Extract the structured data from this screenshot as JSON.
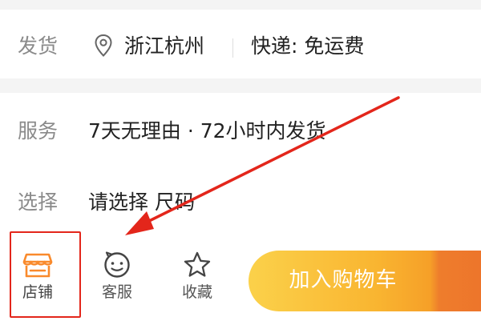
{
  "shipping": {
    "label": "发货",
    "location": "浙江杭州",
    "express": "快递: 免运费"
  },
  "service": {
    "label": "服务",
    "value": "7天无理由 · 72小时内发货"
  },
  "selection": {
    "label": "选择",
    "value": "请选择 尺码"
  },
  "action_bar": {
    "store_label": "店铺",
    "customer_service_label": "客服",
    "favorite_label": "收藏",
    "add_to_cart_label": "加入购物车"
  },
  "annotation_color": "#e3261b",
  "accent_color": "#f98a2c"
}
